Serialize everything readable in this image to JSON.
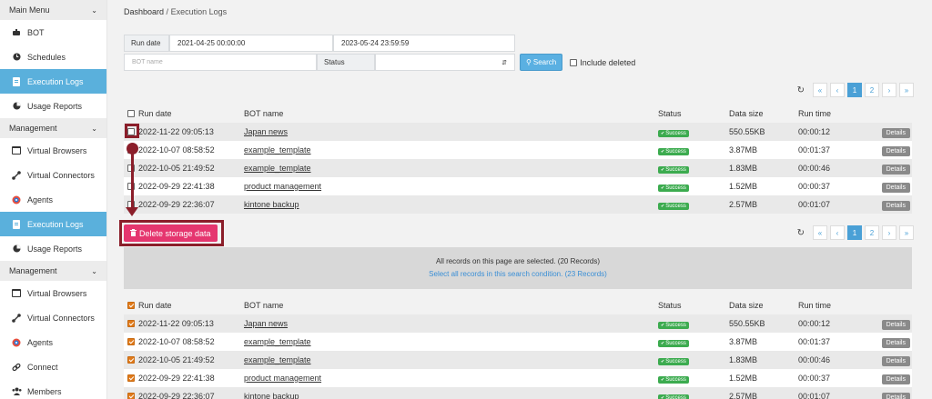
{
  "sidebar": {
    "main_menu": "Main Menu",
    "items_top": [
      {
        "label": "BOT",
        "icon": "bot-icon"
      },
      {
        "label": "Schedules",
        "icon": "clock-icon"
      },
      {
        "label": "Execution Logs",
        "icon": "document-icon",
        "active": true
      },
      {
        "label": "Usage Reports",
        "icon": "chart-icon"
      }
    ],
    "management1": "Management",
    "items_mid": [
      {
        "label": "Virtual Browsers",
        "icon": "browser-icon"
      },
      {
        "label": "Virtual Connectors",
        "icon": "connector-icon"
      },
      {
        "label": "Agents",
        "icon": "agent-icon"
      },
      {
        "label": "Execution Logs",
        "icon": "document-icon",
        "active": true
      },
      {
        "label": "Usage Reports",
        "icon": "chart-icon"
      }
    ],
    "management2": "Management",
    "items_bot": [
      {
        "label": "Virtual Browsers",
        "icon": "browser-icon"
      },
      {
        "label": "Virtual Connectors",
        "icon": "connector-icon"
      },
      {
        "label": "Agents",
        "icon": "agent-icon"
      },
      {
        "label": "Connect",
        "icon": "link-icon"
      },
      {
        "label": "Members",
        "icon": "members-icon"
      }
    ]
  },
  "breadcrumb": {
    "first": "Dashboard",
    "sep": "/",
    "current": "Execution Logs"
  },
  "filter": {
    "run_date_label": "Run date",
    "date_from": "2021-04-25 00:00:00",
    "date_to": "2023-05-24 23:59:59",
    "bot_name_placeholder": "BOT name",
    "status_label": "Status",
    "search_label": "Search",
    "include_deleted": "Include deleted"
  },
  "pager": {
    "first": "«",
    "prev": "‹",
    "pages": [
      "1",
      "2"
    ],
    "next": "›",
    "last": "»",
    "refresh": "↻"
  },
  "table": {
    "headers": {
      "run_date": "Run date",
      "bot_name": "BOT name",
      "status": "Status",
      "data_size": "Data size",
      "run_time": "Run time"
    },
    "details_label": "Details",
    "rows": [
      {
        "date": "2022-11-22 09:05:13",
        "name": "Japan news",
        "status": "Success",
        "size": "550.55KB",
        "time": "00:00:12"
      },
      {
        "date": "2022-10-07 08:58:52",
        "name": "example_template",
        "status": "Success",
        "size": "3.87MB",
        "time": "00:01:37"
      },
      {
        "date": "2022-10-05 21:49:52",
        "name": "example_template",
        "status": "Success",
        "size": "1.83MB",
        "time": "00:00:46"
      },
      {
        "date": "2022-09-29 22:41:38",
        "name": "product management",
        "status": "Success",
        "size": "1.52MB",
        "time": "00:00:37"
      },
      {
        "date": "2022-09-29 22:36:07",
        "name": "kintone backup",
        "status": "Success",
        "size": "2.57MB",
        "time": "00:01:07"
      }
    ]
  },
  "delete_button": "Delete storage data",
  "banner": {
    "line1": "All records on this page are selected. (20 Records)",
    "line2": "Select all records in this search condition. (23 Records)"
  },
  "colors": {
    "accent": "#5ab0dc",
    "delete": "#e5366f",
    "annotation": "#8b1e2a",
    "success": "#3cab4f"
  }
}
